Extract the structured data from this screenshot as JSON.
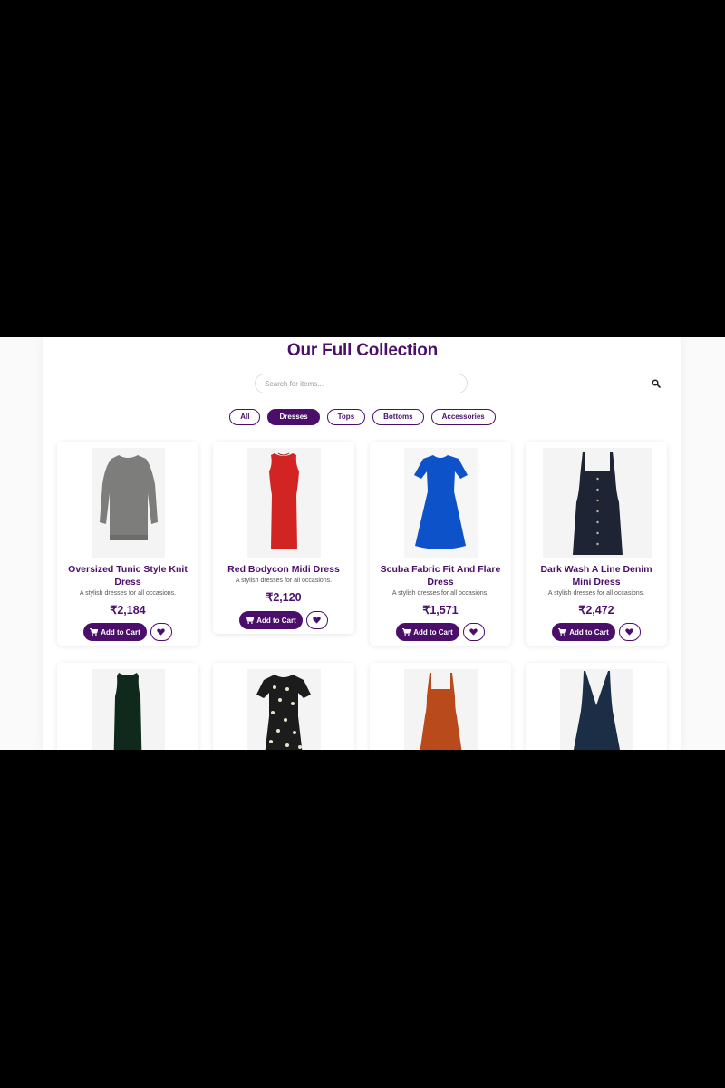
{
  "page": {
    "title": "Our Full Collection"
  },
  "search": {
    "placeholder": "Search for items..."
  },
  "filters": [
    {
      "label": "All",
      "active": false
    },
    {
      "label": "Dresses",
      "active": true
    },
    {
      "label": "Tops",
      "active": false
    },
    {
      "label": "Bottoms",
      "active": false
    },
    {
      "label": "Accessories",
      "active": false
    }
  ],
  "colors": {
    "brand": "#4b0e6b"
  },
  "products": [
    {
      "name": "Oversized Tunic Style Knit Dress",
      "description": "A stylish dresses for all occasions.",
      "price": "₹2,184",
      "cart_label": "Add to Cart",
      "image": "grey-knit-dress"
    },
    {
      "name": "Red Bodycon Midi Dress",
      "description": "A stylish dresses for all occasions.",
      "price": "₹2,120",
      "cart_label": "Add to Cart",
      "image": "red-bodycon-dress"
    },
    {
      "name": "Scuba Fabric Fit And Flare Dress",
      "description": "A stylish dresses for all occasions.",
      "price": "₹1,571",
      "cart_label": "Add to Cart",
      "image": "blue-flare-dress"
    },
    {
      "name": "Dark Wash A Line Denim Mini Dress",
      "description": "A stylish dresses for all occasions.",
      "price": "₹2,472",
      "cart_label": "Add to Cart",
      "image": "denim-mini-dress"
    }
  ],
  "products_row2": [
    {
      "image": "green-velvet-dress"
    },
    {
      "image": "floral-wrap-dress"
    },
    {
      "image": "rust-midi-dress"
    },
    {
      "image": "navy-gown"
    }
  ]
}
